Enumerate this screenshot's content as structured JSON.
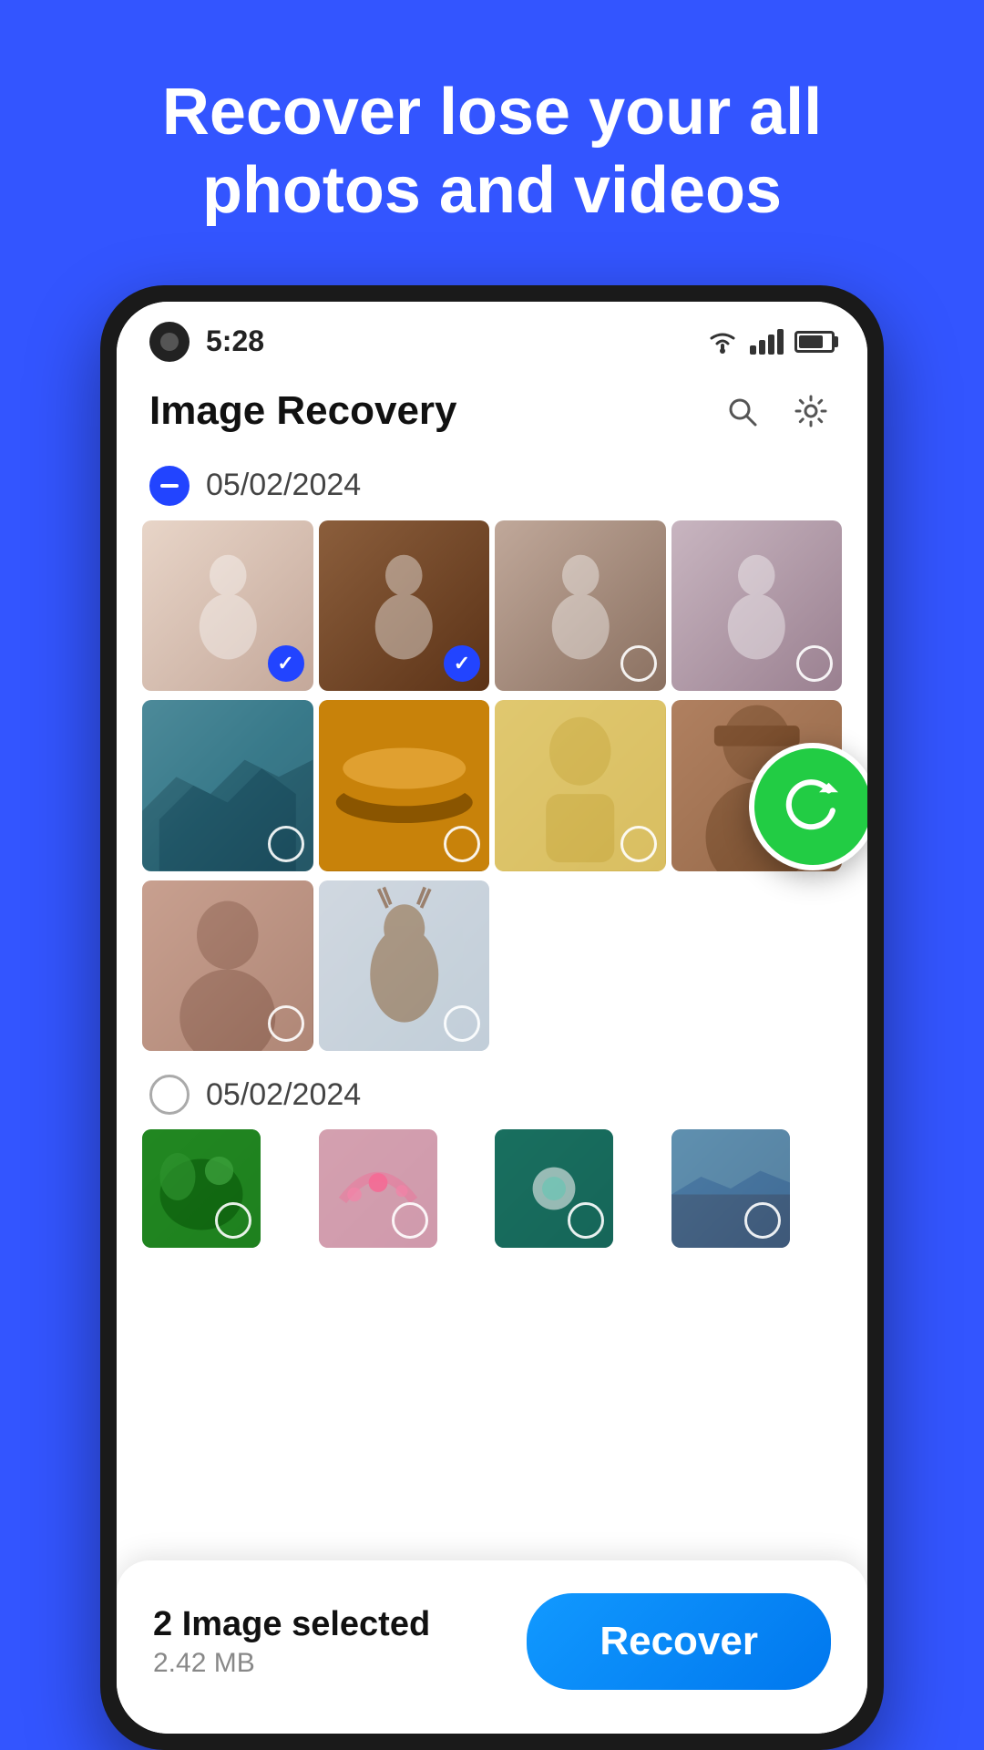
{
  "hero": {
    "title": "Recover lose your all photos and videos"
  },
  "status_bar": {
    "time": "5:28"
  },
  "app_header": {
    "title": "Image Recovery"
  },
  "section1": {
    "date": "05/02/2024",
    "selected": true
  },
  "section2": {
    "date": "05/02/2024",
    "selected": false
  },
  "photos_row1": [
    {
      "id": 1,
      "checked": true,
      "color_class": "p1"
    },
    {
      "id": 2,
      "checked": true,
      "color_class": "p2"
    },
    {
      "id": 3,
      "checked": false,
      "color_class": "p3"
    },
    {
      "id": 4,
      "checked": false,
      "color_class": "p4"
    }
  ],
  "photos_row2": [
    {
      "id": 5,
      "checked": false,
      "color_class": "p5"
    },
    {
      "id": 6,
      "checked": false,
      "color_class": "p6"
    },
    {
      "id": 7,
      "checked": false,
      "color_class": "p7"
    },
    {
      "id": 8,
      "checked": false,
      "color_class": "p8"
    }
  ],
  "photos_row3": [
    {
      "id": 9,
      "checked": false,
      "color_class": "p9"
    },
    {
      "id": 10,
      "checked": false,
      "color_class": "p10"
    }
  ],
  "photos_row4": [
    {
      "id": 13,
      "checked": false,
      "color_class": "p13"
    },
    {
      "id": 14,
      "checked": false,
      "color_class": "p14"
    },
    {
      "id": 15,
      "checked": false,
      "color_class": "p15"
    },
    {
      "id": 16,
      "checked": false,
      "color_class": "p16"
    }
  ],
  "bottom_bar": {
    "selected_count": "2 Image selected",
    "selected_size": "2.42 MB",
    "recover_label": "Recover"
  }
}
